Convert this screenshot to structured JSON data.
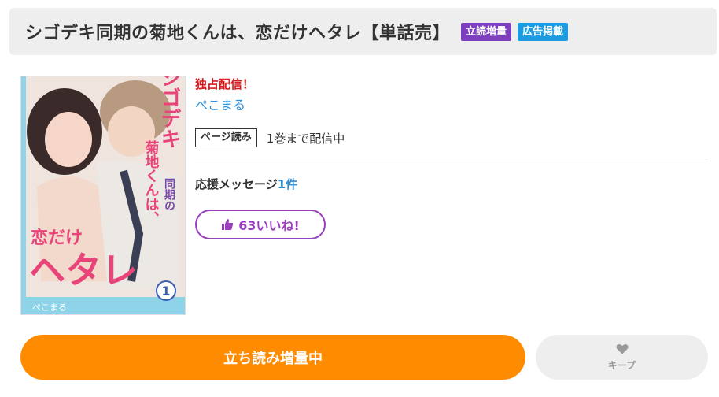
{
  "header": {
    "title": "シゴデキ同期の菊地くんは、恋だけヘタレ【単話売】",
    "badges": {
      "campaign": "立読増量",
      "ad": "広告掲載"
    }
  },
  "cover": {
    "title_text": "シゴデキ同期の菊地くんは、恋だけヘタレ",
    "author_text": "ぺこまる",
    "volume": "1",
    "colors": {
      "title_pink": "#e8447a",
      "background": "#e9dcd4"
    }
  },
  "info": {
    "exclusive": "独占配信！",
    "author": "ぺこまる",
    "format_tag": "ページ読み",
    "availability": "1巻まで配信中",
    "support_label": "応援メッセージ",
    "support_count": "1件",
    "like_label": "63いいね!"
  },
  "actions": {
    "read_label": "立ち読み増量中",
    "keep_label": "キープ"
  },
  "colors": {
    "accent_orange": "#ff8c00",
    "badge_purple": "#7e3fbf",
    "badge_blue": "#1e9be0",
    "exclusive_red": "#d81b1b",
    "link_blue": "#2f8fd8",
    "like_purple": "#9b3fbf"
  }
}
